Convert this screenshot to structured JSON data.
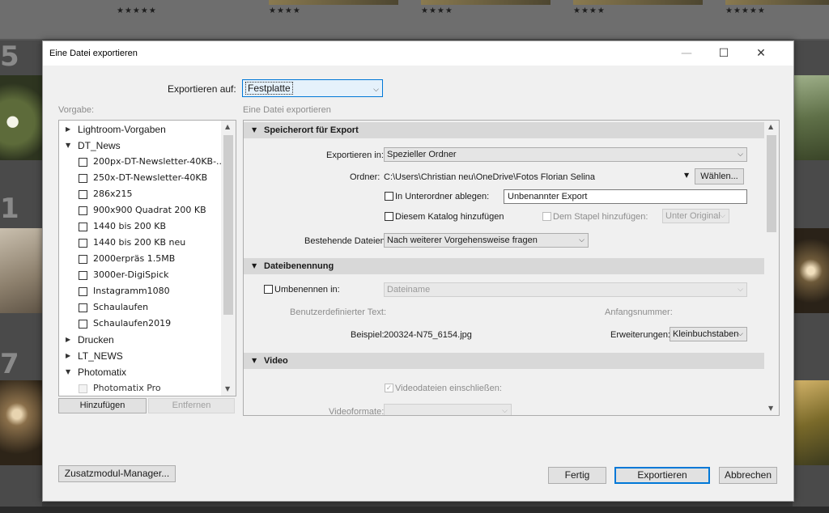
{
  "background": {
    "ratings": [
      "★★★★★",
      "★★★★",
      "★★★★",
      "★★★★",
      "★★★★★"
    ],
    "grid_numbers": [
      "5",
      "1",
      "7"
    ]
  },
  "dialog": {
    "title": "Eine Datei exportieren",
    "export_to_label": "Exportieren auf:",
    "export_to_value": "Festplatte",
    "preset_label": "Vorgabe:",
    "panel_label": "Eine Datei exportieren",
    "presets": [
      {
        "type": "folder",
        "open": false,
        "label": "Lightroom-Vorgaben"
      },
      {
        "type": "folder",
        "open": true,
        "label": "DT_News"
      },
      {
        "type": "item",
        "label": "200px-DT-Newsletter-40KB-..."
      },
      {
        "type": "item",
        "label": "250x-DT-Newsletter-40KB"
      },
      {
        "type": "item",
        "label": "286x215"
      },
      {
        "type": "item",
        "label": "900x900 Quadrat 200 KB"
      },
      {
        "type": "item",
        "label": "1440 bis 200 KB"
      },
      {
        "type": "item",
        "label": "1440 bis 200 KB neu"
      },
      {
        "type": "item",
        "label": "2000erpräs 1.5MB"
      },
      {
        "type": "item",
        "label": "3000er-DigiSpick"
      },
      {
        "type": "item",
        "label": "Instagramm1080"
      },
      {
        "type": "item",
        "label": "Schaulaufen"
      },
      {
        "type": "item",
        "label": "Schaulaufen2019"
      },
      {
        "type": "folder",
        "open": false,
        "label": "Drucken"
      },
      {
        "type": "folder",
        "open": false,
        "label": "LT_NEWS"
      },
      {
        "type": "folder",
        "open": true,
        "label": "Photomatix"
      },
      {
        "type": "item_disabled",
        "label": "Photomatix Pro"
      }
    ],
    "add_button": "Hinzufügen",
    "remove_button": "Entfernen",
    "plugin_manager_button": "Zusatzmodul-Manager...",
    "done_button": "Fertig",
    "export_button": "Exportieren",
    "cancel_button": "Abbrechen",
    "sections": {
      "location": {
        "title": "Speicherort für Export",
        "export_in_label": "Exportieren in:",
        "export_in_value": "Spezieller Ordner",
        "folder_label": "Ordner:",
        "folder_path": "C:\\Users\\Christian neu\\OneDrive\\Fotos Florian Selina",
        "choose_button": "Wählen...",
        "subfolder_label": "In Unterordner ablegen:",
        "subfolder_value": "Unbenannter Export",
        "add_catalog_label": "Diesem Katalog hinzufügen",
        "add_stack_label": "Dem Stapel hinzufügen:",
        "stack_position": "Unter Original",
        "existing_label": "Bestehende Dateien:",
        "existing_value": "Nach weiterer Vorgehensweise fragen"
      },
      "naming": {
        "title": "Dateibenennung",
        "rename_label": "Umbenennen in:",
        "rename_value": "Dateiname",
        "custom_text_label": "Benutzerdefinierter Text:",
        "start_number_label": "Anfangsnummer:",
        "example_label": "Beispiel:",
        "example_value": "200324-N75_6154.jpg",
        "extensions_label": "Erweiterungen:",
        "extensions_value": "Kleinbuchstaben"
      },
      "video": {
        "title": "Video",
        "include_label": "Videodateien einschließen:",
        "format_label": "Videoformate:"
      }
    }
  }
}
